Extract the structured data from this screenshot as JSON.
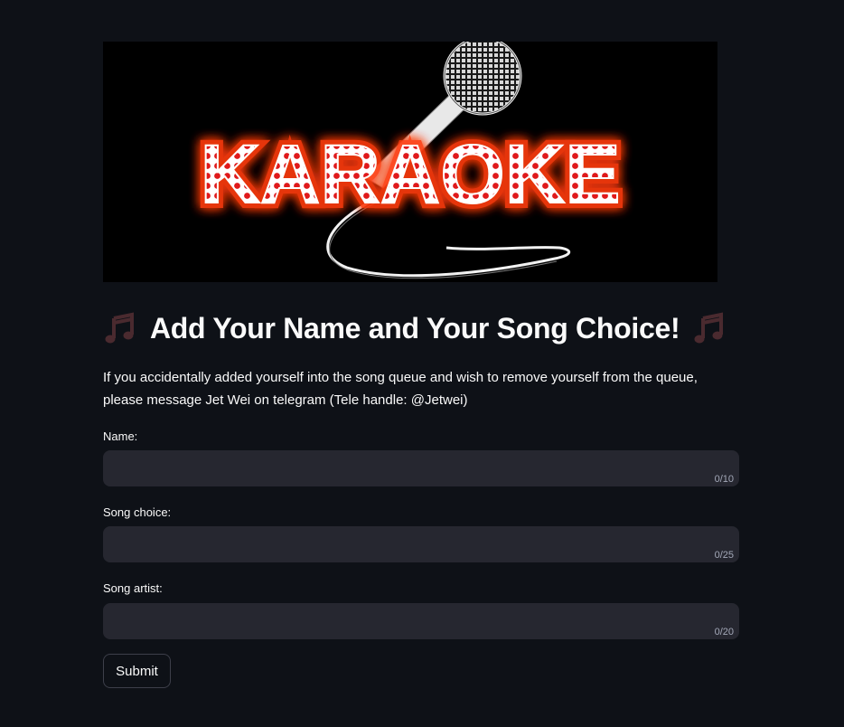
{
  "banner": {
    "text": "KARAOKE",
    "colors": {
      "background": "#000000",
      "glow": "#ff3b0a",
      "bulb": "#e0191b",
      "letter": "#ffffff"
    }
  },
  "heading": {
    "title": "Add Your Name and Your Song Choice!",
    "icon_left": "musical-notes-icon",
    "icon_right": "musical-notes-icon"
  },
  "notice": {
    "text": "If you accidentally added yourself into the song queue and wish to remove yourself from the queue, please message Jet Wei on telegram (Tele handle: @Jetwei)"
  },
  "form": {
    "fields": [
      {
        "label": "Name:",
        "value": "",
        "counter": "0/10"
      },
      {
        "label": "Song choice:",
        "value": "",
        "counter": "0/25"
      },
      {
        "label": "Song artist:",
        "value": "",
        "counter": "0/20"
      }
    ],
    "submit_label": "Submit"
  },
  "theme": {
    "background": "#0e1117",
    "input_bg": "#262730",
    "text": "#fafafa",
    "muted": "#a3a8b8"
  }
}
